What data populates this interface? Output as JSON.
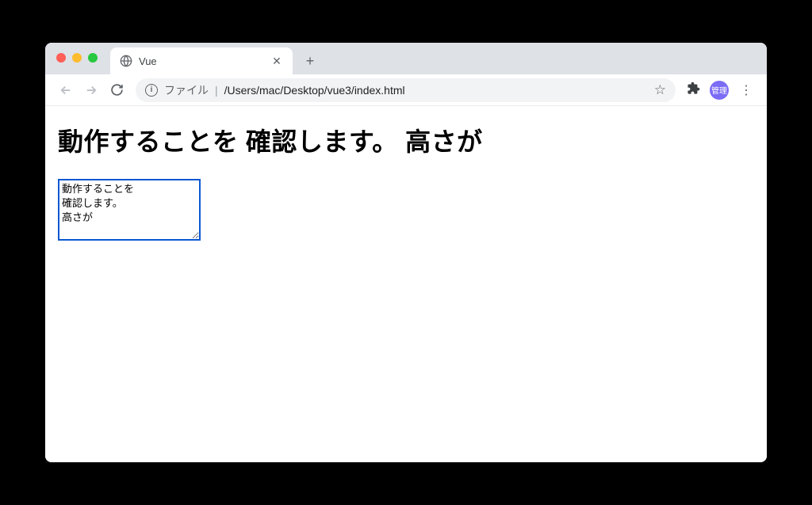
{
  "browser": {
    "tab": {
      "title": "Vue"
    },
    "addressBar": {
      "scheme_label": "ファイル",
      "path": "/Users/mac/Desktop/vue3/index.html"
    },
    "profile_badge": "管理"
  },
  "page": {
    "heading": "動作することを 確認します。 高さが",
    "textarea_value": "動作することを\n確認します。\n高さが"
  }
}
